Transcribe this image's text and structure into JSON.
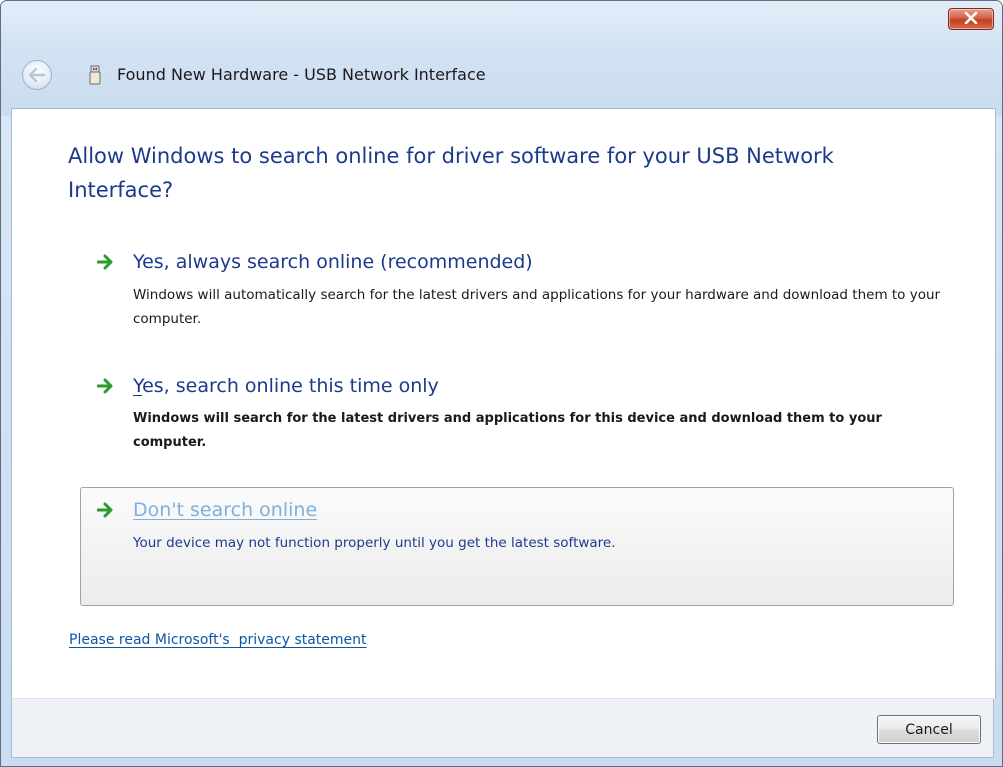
{
  "window": {
    "title": "Found New Hardware - USB Network Interface",
    "close_icon": "close-icon",
    "back_icon": "back-arrow-icon",
    "device_icon": "usb-device-icon"
  },
  "main_instruction": "Allow Windows to search online for driver software for your USB Network Interface?",
  "options": [
    {
      "title": "Yes, always search online (recommended)",
      "description": "Windows will automatically search for the latest drivers and applications for your hardware and download them to your computer.",
      "icon": "green-arrow-icon",
      "state": "normal"
    },
    {
      "title_mnemonic": "Y",
      "title_rest": "es, search online this time only",
      "description": "Windows will search for the latest drivers and applications for this device and download them to your computer.",
      "icon": "green-arrow-icon",
      "state": "bold"
    },
    {
      "title_mnemonic": "D",
      "title_rest": "on't search online",
      "description": "Your device may not function properly until you get the latest software.",
      "icon": "green-arrow-icon",
      "state": "hover"
    }
  ],
  "privacy_link": "Please read Microsoft's  privacy statement",
  "buttons": {
    "cancel": "Cancel"
  },
  "colors": {
    "instruction": "#1c3a8c",
    "link": "#0a58a3",
    "arrow": "#2a9a2a",
    "hover_title": "#7fb0dc"
  }
}
